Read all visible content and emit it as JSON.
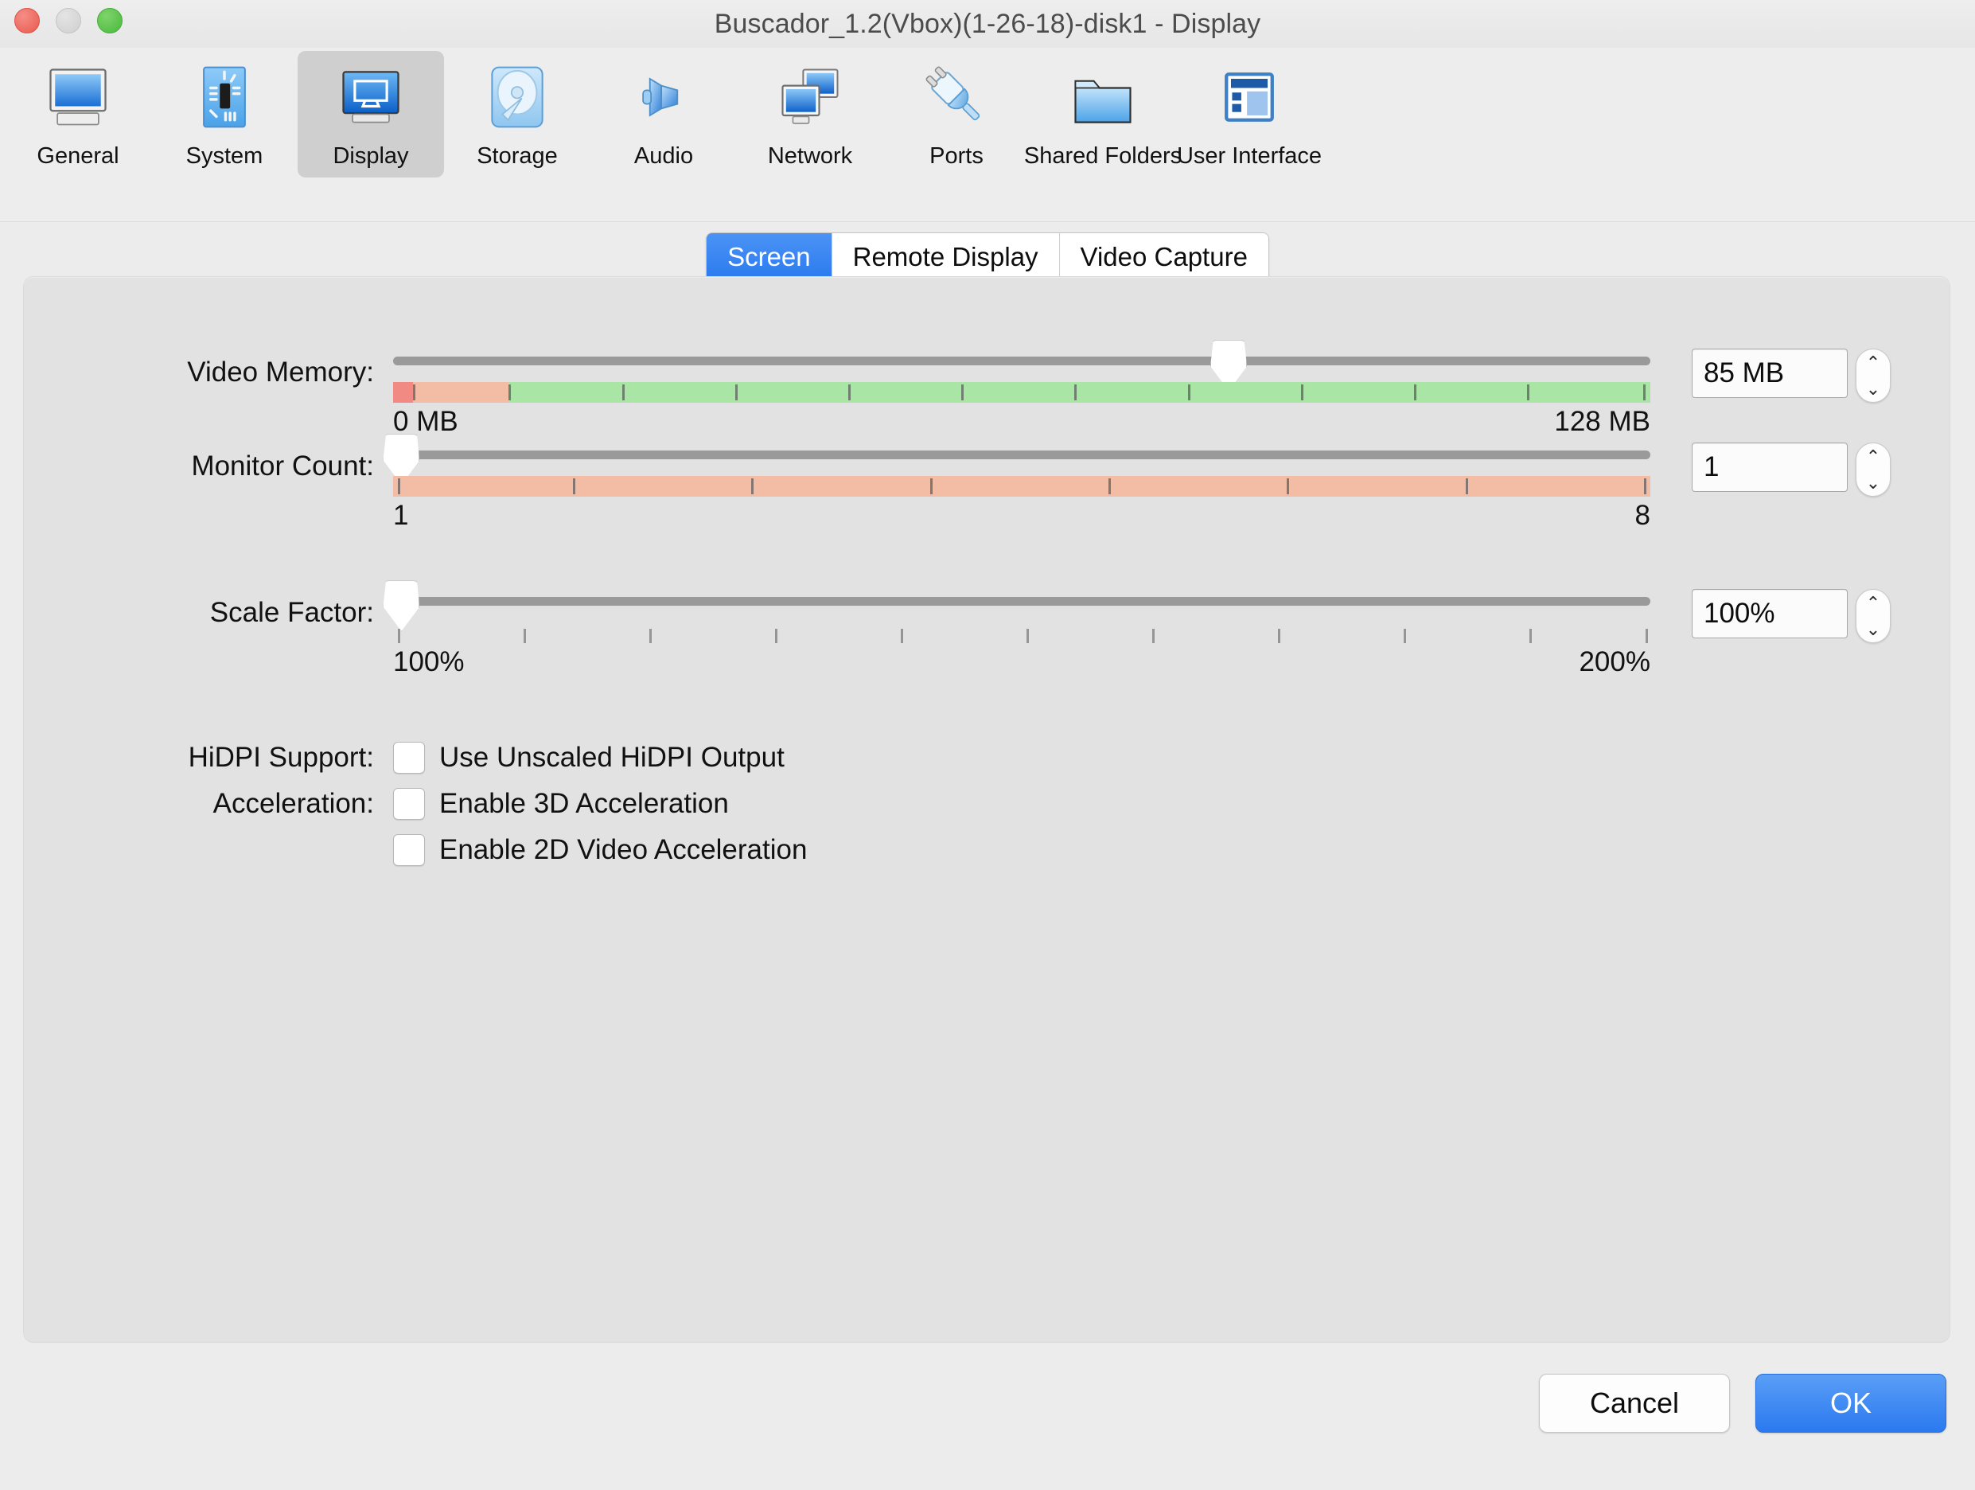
{
  "window": {
    "title": "Buscador_1.2(Vbox)(1-26-18)-disk1 - Display",
    "traffic_lights": [
      {
        "name": "close",
        "color": "#e8594e"
      },
      {
        "name": "minimize",
        "color": "#cfcfcf"
      },
      {
        "name": "zoom",
        "color": "#49b93a"
      }
    ]
  },
  "toolbar": {
    "items": [
      {
        "label": "General",
        "icon": "monitor-icon",
        "selected": false
      },
      {
        "label": "System",
        "icon": "chip-icon",
        "selected": false
      },
      {
        "label": "Display",
        "icon": "display-icon",
        "selected": true
      },
      {
        "label": "Storage",
        "icon": "disk-icon",
        "selected": false
      },
      {
        "label": "Audio",
        "icon": "speaker-icon",
        "selected": false
      },
      {
        "label": "Network",
        "icon": "network-icon",
        "selected": false
      },
      {
        "label": "Ports",
        "icon": "plug-icon",
        "selected": false
      },
      {
        "label": "Shared Folders",
        "icon": "folder-icon",
        "selected": false
      },
      {
        "label": "User Interface",
        "icon": "window-layout-icon",
        "selected": false
      }
    ]
  },
  "tabs": [
    {
      "label": "Screen",
      "active": true
    },
    {
      "label": "Remote Display",
      "active": false
    },
    {
      "label": "Video Capture",
      "active": false
    }
  ],
  "settings": {
    "video_memory": {
      "label": "Video Memory:",
      "value": "85 MB",
      "min_label": "0 MB",
      "max_label": "128 MB",
      "handle_percent": 66.4,
      "gauge_segments": [
        {
          "color": "#f08a82",
          "percent": 1.6
        },
        {
          "color": "#f2bda4",
          "percent": 7.6
        },
        {
          "color": "#a9e6a5",
          "percent": 90.8
        }
      ],
      "tick_percents": [
        1.6,
        9.2,
        18.2,
        27.2,
        36.2,
        45.2,
        54.2,
        63.2,
        72.2,
        81.2,
        90.2,
        99.4
      ]
    },
    "monitor_count": {
      "label": "Monitor Count:",
      "value": "1",
      "min_label": "1",
      "max_label": "8",
      "handle_percent": 0.6,
      "gauge_segments": [
        {
          "color": "#f2bda4",
          "percent": 100
        }
      ],
      "tick_percents": [
        0.4,
        14.3,
        28.5,
        42.7,
        56.9,
        71.1,
        85.3,
        99.5
      ]
    },
    "scale_factor": {
      "label": "Scale Factor:",
      "value": "100%",
      "min_label": "100%",
      "max_label": "200%",
      "handle_percent": 0.6,
      "gauge_segments": [],
      "tick_percents": [
        0.4,
        10.4,
        20.4,
        30.4,
        40.4,
        50.4,
        60.4,
        70.4,
        80.4,
        90.4,
        99.6
      ]
    },
    "hidpi": {
      "label": "HiDPI Support:",
      "checkbox_label": "Use Unscaled HiDPI Output",
      "checked": false
    },
    "acceleration": {
      "label": "Acceleration:",
      "options": [
        {
          "checkbox_label": "Enable 3D Acceleration",
          "checked": false
        },
        {
          "checkbox_label": "Enable 2D Video Acceleration",
          "checked": false
        }
      ]
    }
  },
  "footer": {
    "cancel_label": "Cancel",
    "ok_label": "OK"
  },
  "stepper_glyphs": {
    "up": "⌃",
    "down": "⌄"
  }
}
